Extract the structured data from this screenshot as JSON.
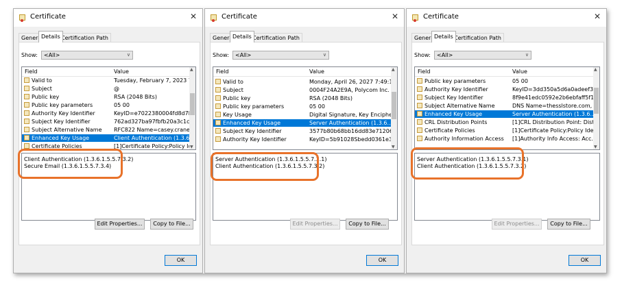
{
  "dialogs": [
    {
      "title": "Certificate",
      "tabs": [
        "General",
        "Details",
        "Certification Path"
      ],
      "show_label": "Show:",
      "show_value": "<All>",
      "columns": {
        "field": "Field",
        "value": "Value"
      },
      "rows": [
        {
          "field": "Valid to",
          "value": "Tuesday, February 7, 2023 7:5..."
        },
        {
          "field": "Subject",
          "value": "@"
        },
        {
          "field": "Public key",
          "value": "RSA (2048 Bits)"
        },
        {
          "field": "Public key parameters",
          "value": "05 00"
        },
        {
          "field": "Authority Key Identifier",
          "value": "KeyID=e7022380004fd8d7bc9..."
        },
        {
          "field": "Subject Key Identifier",
          "value": "762ad327ba97fbfb20a3c1c3b3..."
        },
        {
          "field": "Subject Alternative Name",
          "value": "RFC822 Name=casey.crane@c..."
        },
        {
          "field": "Enhanced Key Usage",
          "value": "Client Authentication (1.3.6.1.5...",
          "selected": true
        },
        {
          "field": "Certificate Policies",
          "value": "[1]Certificate Policy:Policy Ide..."
        }
      ],
      "details": [
        "Client Authentication (1.3.6.1.5.5.7.3.2)",
        "Secure Email (1.3.6.1.5.5.7.3.4)"
      ],
      "edit_properties": "Edit Properties...",
      "copy_to_file": "Copy to File...",
      "ok": "OK"
    },
    {
      "title": "Certificate",
      "tabs": [
        "General",
        "Details",
        "Certification Path"
      ],
      "show_label": "Show:",
      "show_value": "<All>",
      "columns": {
        "field": "Field",
        "value": "Value"
      },
      "rows": [
        {
          "field": "Valid to",
          "value": "Monday, April 26, 2027 7:49:1..."
        },
        {
          "field": "Subject",
          "value": "0004F24A2E9A, Polycom Inc."
        },
        {
          "field": "Public key",
          "value": "RSA (2048 Bits)"
        },
        {
          "field": "Public key parameters",
          "value": "05 00"
        },
        {
          "field": "Key Usage",
          "value": "Digital Signature, Key Encipher..."
        },
        {
          "field": "Enhanced Key Usage",
          "value": "Server Authentication (1.3.6....",
          "selected": true
        },
        {
          "field": "Subject Key Identifier",
          "value": "3577b80b68bb16dd83e71206..."
        },
        {
          "field": "Authority Key Identifier",
          "value": "KeyID=5b91028Sbedd0361e3..."
        }
      ],
      "details": [
        "Server Authentication (1.3.6.1.5.5.7.3.1)",
        "Client Authentication (1.3.6.1.5.5.7.3.2)"
      ],
      "edit_properties": "Edit Properties...",
      "copy_to_file": "Copy to File...",
      "ok": "OK"
    },
    {
      "title": "Certificate",
      "tabs": [
        "General",
        "Details",
        "Certification Path"
      ],
      "show_label": "Show:",
      "show_value": "<All>",
      "columns": {
        "field": "Field",
        "value": "Value"
      },
      "rows": [
        {
          "field": "Public key parameters",
          "value": "05 00"
        },
        {
          "field": "Authority Key Identifier",
          "value": "KeyID=3dd350a5d6a0adeef3..."
        },
        {
          "field": "Subject Key Identifier",
          "value": "8f9e41edc0592e2b6ebfaff5f1..."
        },
        {
          "field": "Subject Alternative Name",
          "value": "DNS Name=thesslstore.com, ..."
        },
        {
          "field": "Enhanced Key Usage",
          "value": "Server Authentication (1.3.6....",
          "selected": true
        },
        {
          "field": "CRL Distribution Points",
          "value": "[1]CRL Distribution Point: Distr..."
        },
        {
          "field": "Certificate Policies",
          "value": "[1]Certificate Policy:Policy Ide..."
        },
        {
          "field": "Authority Information Access",
          "value": "[1]Authority Info Access: Acc..."
        }
      ],
      "details": [
        "Server Authentication (1.3.6.1.5.5.7.3.1)",
        "Client Authentication (1.3.6.1.5.5.7.3.2)"
      ],
      "edit_properties": "Edit Properties...",
      "copy_to_file": "Copy to File...",
      "ok": "OK"
    }
  ],
  "icons": {
    "close": "close-icon",
    "cert": "certificate-icon",
    "dropdown": "chevron-down-icon"
  },
  "colors": {
    "selection": "#0078d7",
    "highlight_ring": "#e8722a"
  }
}
